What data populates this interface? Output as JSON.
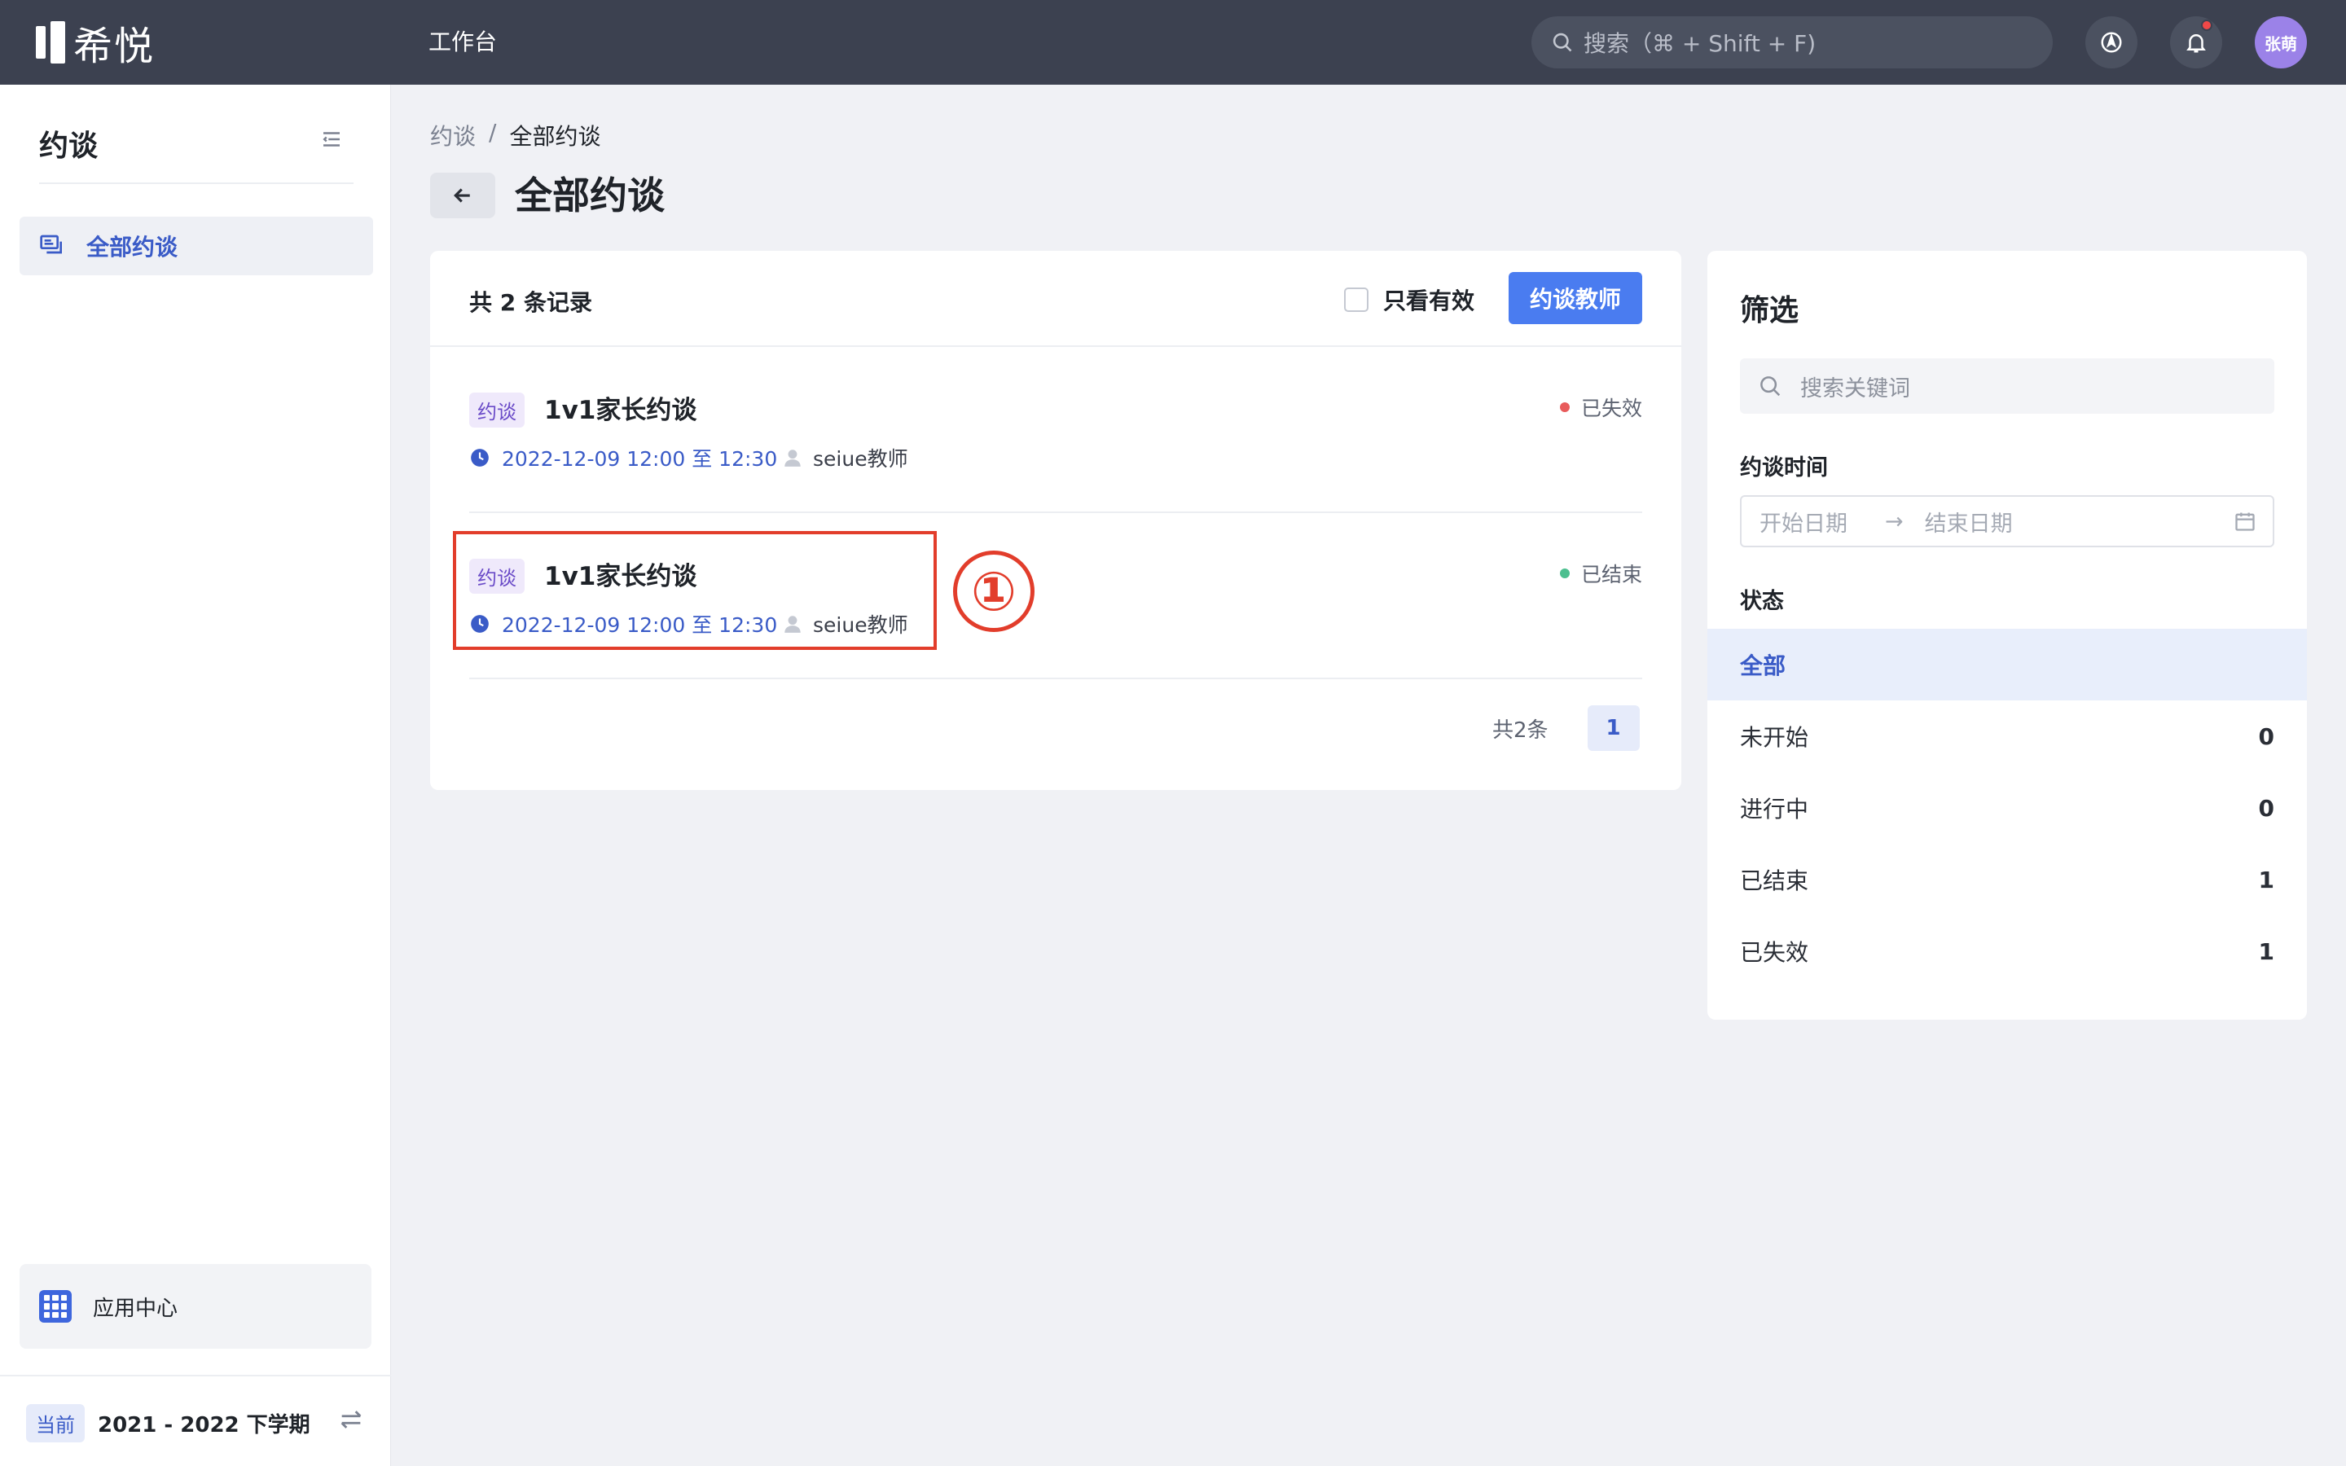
{
  "app": {
    "brand": "希悦",
    "nav_title": "工作台"
  },
  "topbar": {
    "search_placeholder": "搜索（⌘ + Shift + F)",
    "avatar_text": "张萌",
    "has_notification": true
  },
  "sidebar": {
    "title": "约谈",
    "items": [
      {
        "label": "全部约谈",
        "active": true
      }
    ],
    "app_center_label": "应用中心",
    "term_badge": "当前",
    "term_label": "2021 - 2022 下学期"
  },
  "breadcrumb": [
    "约谈",
    "全部约谈"
  ],
  "page_title": "全部约谈",
  "list": {
    "count_text": "共 2 条记录",
    "only_valid_label": "只看有效",
    "only_valid_checked": false,
    "primary_button": "约谈教师",
    "records": [
      {
        "tag": "约谈",
        "title": "1v1家长约谈",
        "time": "2022-12-09 12:00 至 12:30",
        "user": "seiue教师",
        "status": "已失效",
        "status_color": "#e85b5b"
      },
      {
        "tag": "约谈",
        "title": "1v1家长约谈",
        "time": "2022-12-09 12:00 至 12:30",
        "user": "seiue教师",
        "status": "已结束",
        "status_color": "#4cbf8f"
      }
    ],
    "pager_total": "共2条",
    "current_page": "1"
  },
  "annotation": {
    "marker": "①"
  },
  "filter": {
    "title": "筛选",
    "search_placeholder": "搜索关键词",
    "time_label": "约谈时间",
    "start_placeholder": "开始日期",
    "end_placeholder": "结束日期",
    "status_label": "状态",
    "statuses": [
      {
        "label": "全部",
        "count": null,
        "active": true
      },
      {
        "label": "未开始",
        "count": "0",
        "active": false
      },
      {
        "label": "进行中",
        "count": "0",
        "active": false
      },
      {
        "label": "已结束",
        "count": "1",
        "active": false
      },
      {
        "label": "已失效",
        "count": "1",
        "active": false
      }
    ]
  },
  "colors": {
    "topbar": "#3c4150",
    "accent": "#4a7cf0",
    "annotation": "#e23d2b"
  }
}
